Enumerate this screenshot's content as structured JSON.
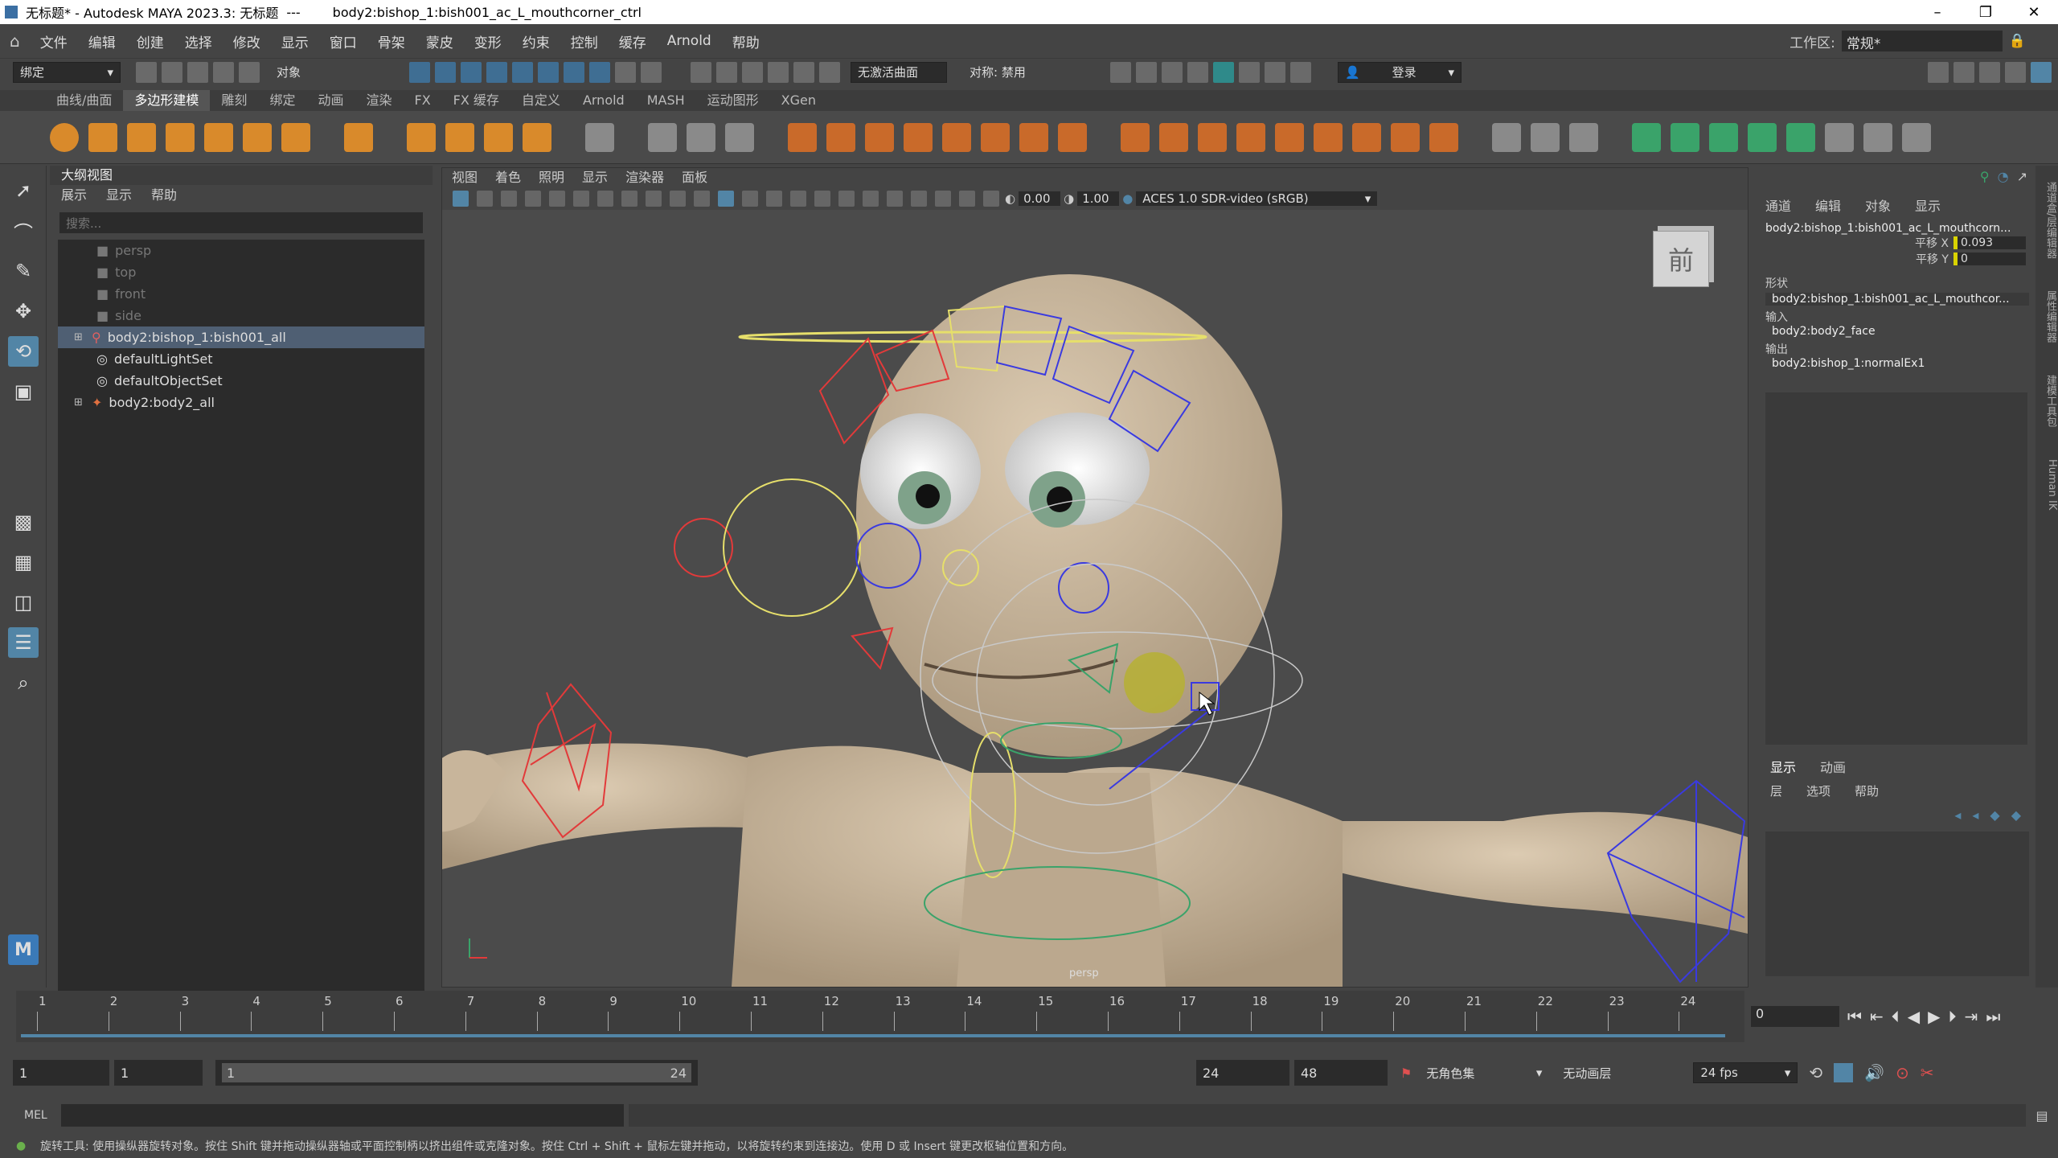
{
  "titlebar": {
    "title": "无标题* - Autodesk MAYA 2023.3: 无标题",
    "sep": "---",
    "file": "body2:bishop_1:bish001_ac_L_mouthcorner_ctrl",
    "min": "–",
    "max": "❐",
    "close": "✕"
  },
  "menubar": {
    "items": [
      "文件",
      "编辑",
      "创建",
      "选择",
      "修改",
      "显示",
      "窗口",
      "骨架",
      "蒙皮",
      "变形",
      "约束",
      "控制",
      "缓存",
      "Arnold",
      "帮助"
    ],
    "workspace_label": "工作区:",
    "workspace_value": "常规*"
  },
  "statusline": {
    "mode": "绑定",
    "object": "对象",
    "live": "无激活曲面",
    "symmetry": "对称: 禁用",
    "login": "登录"
  },
  "shelf_tabs": [
    "曲线/曲面",
    "多边形建模",
    "雕刻",
    "绑定",
    "动画",
    "渲染",
    "FX",
    "FX 缓存",
    "自定义",
    "Arnold",
    "MASH",
    "运动图形",
    "XGen"
  ],
  "shelf_active": 1,
  "outliner": {
    "header": "大纲视图",
    "menu": [
      "展示",
      "显示",
      "帮助"
    ],
    "search_placeholder": "搜索...",
    "items": [
      {
        "label": "persp",
        "dim": true
      },
      {
        "label": "top",
        "dim": true
      },
      {
        "label": "front",
        "dim": true
      },
      {
        "label": "side",
        "dim": true
      },
      {
        "label": "body2:bishop_1:bish001_all",
        "selected": true
      },
      {
        "label": "defaultLightSet"
      },
      {
        "label": "defaultObjectSet"
      },
      {
        "label": "body2:body2_all"
      }
    ]
  },
  "viewport": {
    "menu": [
      "视图",
      "着色",
      "照明",
      "显示",
      "渲染器",
      "面板"
    ],
    "exposure": "0.00",
    "gamma": "1.00",
    "colorspace": "ACES 1.0 SDR-video (sRGB)",
    "camera": "persp",
    "viewcube": "前"
  },
  "channelbox": {
    "menu": [
      "通道",
      "编辑",
      "对象",
      "显示"
    ],
    "node": "body2:bishop_1:bish001_ac_L_mouthcorn...",
    "attrs": [
      {
        "name": "平移 X",
        "value": "0.093"
      },
      {
        "name": "平移 Y",
        "value": "0"
      }
    ],
    "shape_label": "形状",
    "shape": "body2:bishop_1:bish001_ac_L_mouthcor...",
    "input_label": "输入",
    "input": "body2:body2_face",
    "output_label": "输出",
    "output": "body2:bishop_1:normalEx1"
  },
  "layer": {
    "tabs": [
      "显示",
      "动画"
    ],
    "menu": [
      "层",
      "选项",
      "帮助"
    ]
  },
  "rightstrip": [
    "通道盒/层编辑器",
    "属性编辑器",
    "建模工具包",
    "Human IK"
  ],
  "timeline": {
    "ticks": [
      "1",
      "2",
      "3",
      "4",
      "5",
      "6",
      "7",
      "8",
      "9",
      "10",
      "11",
      "12",
      "13",
      "14",
      "15",
      "16",
      "17",
      "18",
      "19",
      "20",
      "21",
      "22",
      "23",
      "24"
    ],
    "current": "0"
  },
  "range": {
    "start": "1",
    "playstart": "1",
    "slider_start": "1",
    "slider_end": "24",
    "playend": "24",
    "end": "48",
    "charset": "无角色集",
    "animlayer": "无动画层",
    "fps": "24 fps"
  },
  "cmd": {
    "lang": "MEL"
  },
  "help": "旋转工具: 使用操纵器旋转对象。按住 Shift 键并拖动操纵器轴或平面控制柄以挤出组件或克隆对象。按住 Ctrl + Shift + 鼠标左键并拖动，以将旋转约束到连接边。使用 D 或 Insert 键更改枢轴位置和方向。",
  "colors": {
    "accent": "#5285a6",
    "selected": "#4f5f73",
    "skin": "#cdb9a0"
  }
}
